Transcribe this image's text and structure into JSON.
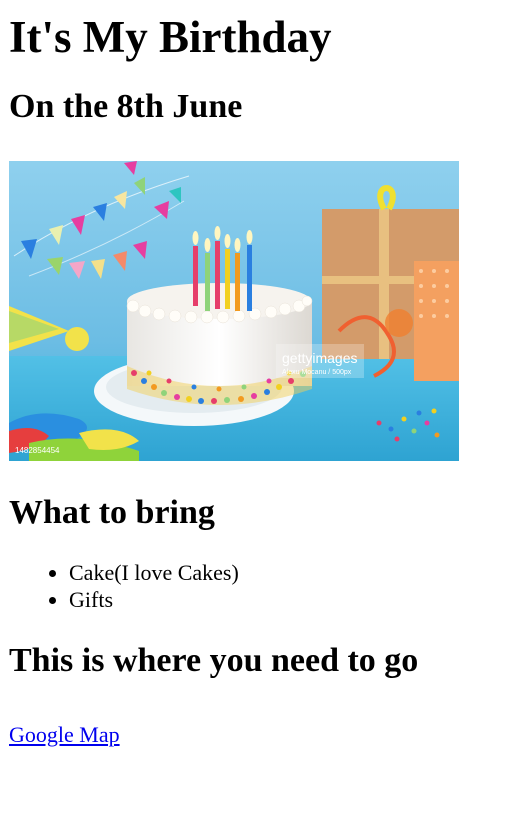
{
  "page": {
    "title": "It's My Birthday",
    "subtitle": "On the 8th June"
  },
  "image": {
    "watermark": "gettyimages",
    "credit": "Alexu Mocanu / 500px",
    "id_text": "1482854454"
  },
  "bring": {
    "heading": "What to bring",
    "items": [
      "Cake(I love Cakes)",
      "Gifts"
    ]
  },
  "directions": {
    "heading": "This is where you need to go",
    "link_text": "Google Map"
  },
  "colors": {
    "link": "#0000ee",
    "sky": "#7ec4e6",
    "table": "#4ab5dd",
    "cake": "#f4f1ec"
  }
}
